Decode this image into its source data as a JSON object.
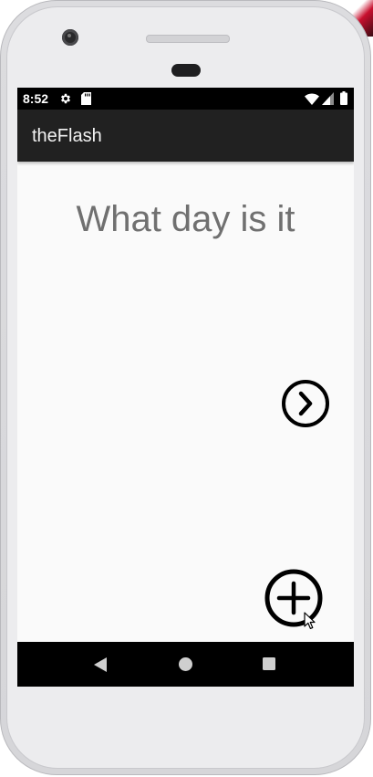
{
  "status_bar": {
    "time": "8:52",
    "icons": [
      "gear-icon",
      "sd-card-icon",
      "wifi-icon",
      "signal-icon",
      "battery-icon"
    ]
  },
  "app_bar": {
    "title": "theFlash"
  },
  "main": {
    "question": "What day is it",
    "next_icon": "chevron-right-circle-icon",
    "add_icon": "plus-circle-icon"
  },
  "nav_bar": {
    "icons": [
      "back-icon",
      "home-icon",
      "recents-icon"
    ]
  },
  "colors": {
    "app_bar": "#212121",
    "screen_bg": "#fafafa",
    "question_text": "#707070",
    "bars": "#000000"
  }
}
